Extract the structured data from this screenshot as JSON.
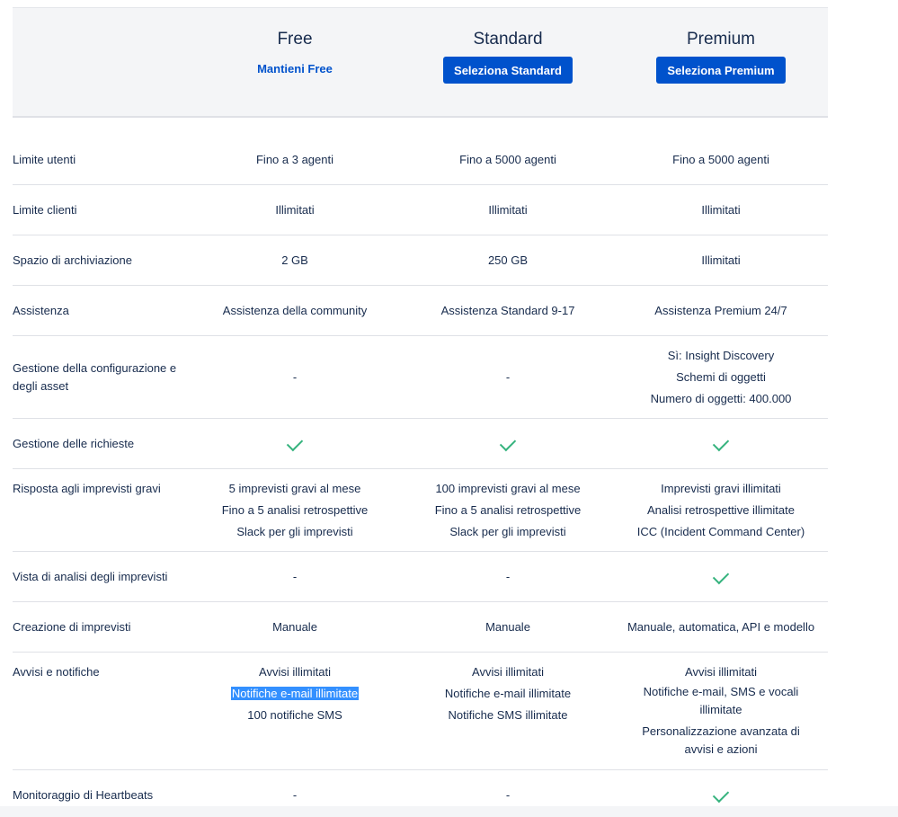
{
  "plans": [
    {
      "name": "Free",
      "action": "Mantieni Free"
    },
    {
      "name": "Standard",
      "action": "Seleziona Standard"
    },
    {
      "name": "Premium",
      "action": "Seleziona Premium"
    }
  ],
  "rows": {
    "user_limit": {
      "label": "Limite utenti",
      "free": "Fino a 3 agenti",
      "standard": "Fino a 5000 agenti",
      "premium": "Fino a 5000 agenti"
    },
    "client_limit": {
      "label": "Limite clienti",
      "free": "Illimitati",
      "standard": "Illimitati",
      "premium": "Illimitati"
    },
    "storage": {
      "label": "Spazio di archiviazione",
      "free": "2 GB",
      "standard": "250 GB",
      "premium": "Illimitati"
    },
    "support": {
      "label": "Assistenza",
      "free": "Assistenza della community",
      "standard": "Assistenza Standard 9-17",
      "premium": "Assistenza Premium 24/7"
    },
    "config": {
      "label_1": "Gestione della configurazione e",
      "label_2": "degli asset",
      "free": "-",
      "standard": "-",
      "premium_1": "Sì: Insight Discovery",
      "premium_2": "Schemi di oggetti",
      "premium_3": "Numero di oggetti: 400.000"
    },
    "requests": {
      "label": "Gestione delle richieste",
      "check_icon": "check-icon"
    },
    "incidents": {
      "label": "Risposta agli imprevisti gravi",
      "free_1": "5 imprevisti gravi al mese",
      "free_2": "Fino a 5 analisi retrospettive",
      "free_3": "Slack per gli imprevisti",
      "standard_1": "100 imprevisti gravi al mese",
      "standard_2": "Fino a 5 analisi retrospettive",
      "standard_3": "Slack per gli imprevisti",
      "premium_1": "Imprevisti gravi illimitati",
      "premium_2": "Analisi retrospettive illimitate",
      "premium_3": "ICC (Incident Command Center)"
    },
    "analytics": {
      "label": "Vista di analisi degli imprevisti",
      "free": "-",
      "standard": "-"
    },
    "creation": {
      "label": "Creazione di imprevisti",
      "free": "Manuale",
      "standard": "Manuale",
      "premium": "Manuale, automatica, API e modello"
    },
    "alerts": {
      "label": "Avvisi e notifiche",
      "free_1": "Avvisi illimitati",
      "free_2": "Notifiche e-mail illimitate",
      "free_3": "100 notifiche SMS",
      "standard_1": "Avvisi illimitati",
      "standard_2": "Notifiche e-mail illimitate",
      "standard_3": "Notifiche SMS illimitate",
      "premium_1": "Avvisi illimitati",
      "premium_2": "Notifiche e-mail, SMS e vocali illimitate",
      "premium_3": "Personalizzazione avanzata di avvisi e azioni"
    },
    "heartbeats": {
      "label": "Monitoraggio di Heartbeats",
      "free": "-",
      "standard": "-"
    }
  },
  "colors": {
    "accent": "#0052cc",
    "check": "#36b37e",
    "header_bg": "#f4f5f7",
    "selection": "#3390ff"
  }
}
